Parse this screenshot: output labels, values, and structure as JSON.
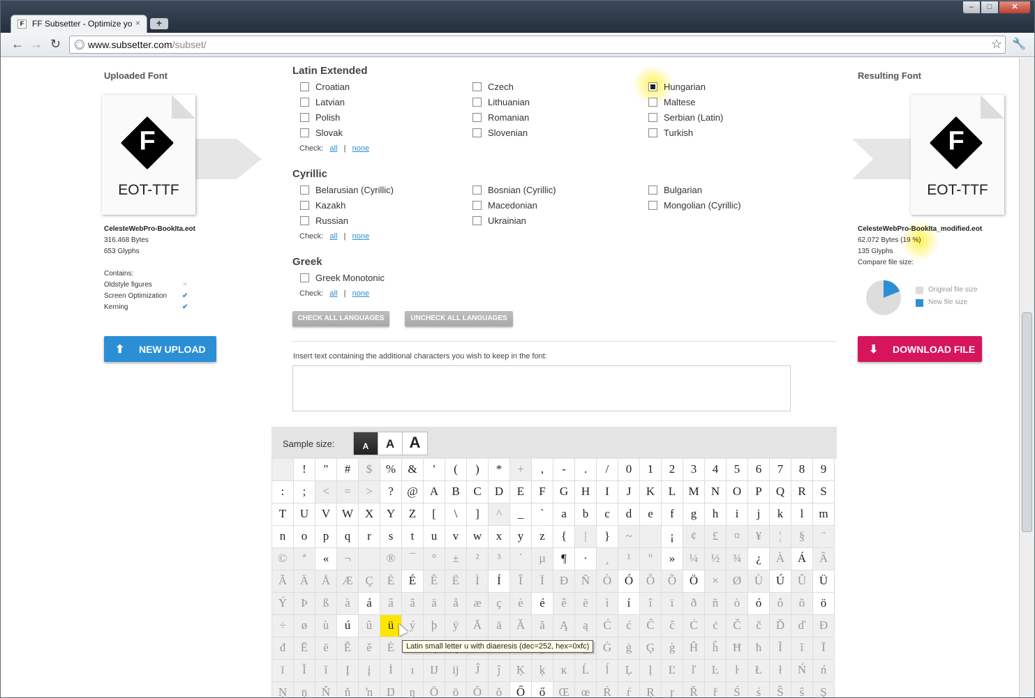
{
  "browser": {
    "tab_title": "FF Subsetter - Optimize yo",
    "tab_favicon": "F",
    "tab_close": "×",
    "new_tab": "+",
    "url_host": "www.subsetter.com",
    "url_path": "/subset/",
    "window_buttons": {
      "min": "‒",
      "max": "□",
      "close": "✕"
    }
  },
  "uploaded": {
    "heading": "Uploaded Font",
    "type": "EOT-TTF",
    "filename": "CelesteWebPro-BookIta.eot",
    "bytes": "316.468 Bytes",
    "glyphs": "653 Glyphs",
    "contains_label": "Contains:",
    "features": [
      {
        "name": "Oldstyle figures",
        "icon": "cross-icon",
        "glyph": "✕"
      },
      {
        "name": "Screen Optimization",
        "icon": "check-icon",
        "glyph": "✔"
      },
      {
        "name": "Kerning",
        "icon": "check-icon",
        "glyph": "✔"
      }
    ],
    "upload_button": "NEW UPLOAD"
  },
  "resulting": {
    "heading": "Resulting Font",
    "type": "EOT-TTF",
    "filename": "CelesteWebPro-BookIta_modified.eot",
    "bytes": "62.072 Bytes (19 %)",
    "glyphs": "135 Glyphs",
    "compare_label": "Compare file size:",
    "legend_original": "Original file size",
    "legend_new": "New file size",
    "new_fraction": 0.19,
    "colors": {
      "original": "#dddddd",
      "new": "#2b8fd6"
    },
    "download_button": "DOWNLOAD FILE"
  },
  "sections": [
    {
      "title": "Latin Extended",
      "columns": [
        [
          {
            "label": "Croatian",
            "checked": false
          },
          {
            "label": "Latvian",
            "checked": false
          },
          {
            "label": "Polish",
            "checked": false
          },
          {
            "label": "Slovak",
            "checked": false
          }
        ],
        [
          {
            "label": "Czech",
            "checked": false
          },
          {
            "label": "Lithuanian",
            "checked": false
          },
          {
            "label": "Romanian",
            "checked": false
          },
          {
            "label": "Slovenian",
            "checked": false
          }
        ],
        [
          {
            "label": "Hungarian",
            "checked": true
          },
          {
            "label": "Maltese",
            "checked": false
          },
          {
            "label": "Serbian (Latin)",
            "checked": false
          },
          {
            "label": "Turkish",
            "checked": false
          }
        ]
      ]
    },
    {
      "title": "Cyrillic",
      "columns": [
        [
          {
            "label": "Belarusian (Cyrillic)",
            "checked": false
          },
          {
            "label": "Kazakh",
            "checked": false
          },
          {
            "label": "Russian",
            "checked": false
          }
        ],
        [
          {
            "label": "Bosnian (Cyrillic)",
            "checked": false
          },
          {
            "label": "Macedonian",
            "checked": false
          },
          {
            "label": "Ukrainian",
            "checked": false
          }
        ],
        [
          {
            "label": "Bulgarian",
            "checked": false
          },
          {
            "label": "Mongolian (Cyrillic)",
            "checked": false
          }
        ]
      ]
    },
    {
      "title": "Greek",
      "columns": [
        [
          {
            "label": "Greek Monotonic",
            "checked": false
          }
        ]
      ]
    }
  ],
  "check_row": {
    "label": "Check:",
    "all": "all",
    "sep": "|",
    "none": "none"
  },
  "check_all_button": "CHECK ALL LANGUAGES",
  "uncheck_all_button": "UNCHECK ALL LANGUAGES",
  "insert_label": "Insert text containing the additional characters you wish to keep in the font:",
  "insert_value": "",
  "sample_size_label": "Sample size:",
  "sample_sizes": [
    "A",
    "A",
    "A"
  ],
  "glyph_rows": [
    [
      " ",
      "!",
      "\"",
      "#",
      "$",
      "%",
      "&",
      "'",
      "(",
      ")",
      "*",
      "+",
      ",",
      "-",
      ".",
      "/",
      "0",
      "1",
      "2",
      "3",
      "4",
      "5",
      "6",
      "7",
      "8",
      "9"
    ],
    [
      ":",
      ";",
      "<",
      "=",
      ">",
      "?",
      "@",
      "A",
      "B",
      "C",
      "D",
      "E",
      "F",
      "G",
      "H",
      "I",
      "J",
      "K",
      "L",
      "M",
      "N",
      "O",
      "P",
      "Q",
      "R",
      "S"
    ],
    [
      "T",
      "U",
      "V",
      "W",
      "X",
      "Y",
      "Z",
      "[",
      "\\",
      "]",
      "^",
      "_",
      "`",
      "a",
      "b",
      "c",
      "d",
      "e",
      "f",
      "g",
      "h",
      "i",
      "j",
      "k",
      "l",
      "m"
    ],
    [
      "n",
      "o",
      "p",
      "q",
      "r",
      "s",
      "t",
      "u",
      "v",
      "w",
      "x",
      "y",
      "z",
      "{",
      "|",
      "}",
      "~",
      " ",
      "¡",
      "¢",
      "£",
      "¤",
      "¥",
      "¦",
      "§",
      "¨"
    ],
    [
      "©",
      "ª",
      "«",
      "¬",
      "­",
      "®",
      "¯",
      "°",
      "±",
      "²",
      "³",
      "´",
      "µ",
      "¶",
      "·",
      "¸",
      "¹",
      "º",
      "»",
      "¼",
      "½",
      "¾",
      "¿",
      "À",
      "Á",
      "Â"
    ],
    [
      "Ã",
      "Ä",
      "Å",
      "Æ",
      "Ç",
      "È",
      "É",
      "Ê",
      "Ë",
      "Ì",
      "Í",
      "Î",
      "Ï",
      "Ð",
      "Ñ",
      "Ò",
      "Ó",
      "Ô",
      "Õ",
      "Ö",
      "×",
      "Ø",
      "Ù",
      "Ú",
      "Û",
      "Ü"
    ],
    [
      "Ý",
      "Þ",
      "ß",
      "à",
      "á",
      "â",
      "ã",
      "ä",
      "å",
      "æ",
      "ç",
      "è",
      "é",
      "ê",
      "ë",
      "ì",
      "í",
      "î",
      "ï",
      "ð",
      "ñ",
      "ò",
      "ó",
      "ô",
      "õ",
      "ö"
    ],
    [
      "÷",
      "ø",
      "ù",
      "ú",
      "û",
      "ü",
      "ý",
      "þ",
      "ÿ",
      "Ā",
      "ā",
      "Ă",
      "ă",
      "Ą",
      "ą",
      "Ć",
      "ć",
      "Ĉ",
      "ĉ",
      "Ċ",
      "ċ",
      "Č",
      "č",
      "Ď",
      "ď",
      "Đ"
    ],
    [
      "đ",
      "Ē",
      "ē",
      "Ĕ",
      "ĕ",
      "Ė",
      "ė",
      "Ę",
      "ę",
      "Ě",
      "ě",
      "Ĝ",
      "ĝ",
      "Ğ",
      "ğ",
      "Ġ",
      "ġ",
      "Ģ",
      "ģ",
      "Ĥ",
      "ĥ",
      "Ħ",
      "ħ",
      "Ĩ",
      "ĩ",
      "Ī"
    ],
    [
      "ī",
      "Ĭ",
      "ĭ",
      "Į",
      "į",
      "İ",
      "ı",
      "Ĳ",
      "ĳ",
      "Ĵ",
      "ĵ",
      "Ķ",
      "ķ",
      "ĸ",
      "Ĺ",
      "ĺ",
      "Ļ",
      "ļ",
      "Ľ",
      "ľ",
      "Ŀ",
      "ŀ",
      "Ł",
      "ł",
      "Ń",
      "ń"
    ],
    [
      "Ņ",
      "ņ",
      "Ň",
      "ň",
      "ŉ",
      "Ŋ",
      "ŋ",
      "Ō",
      "ō",
      "Ŏ",
      "ŏ",
      "Ő",
      "ő",
      "Œ",
      "œ",
      "Ŕ",
      "ŕ",
      "Ŗ",
      "ŗ",
      "Ř",
      "ř",
      "Ś",
      "ś",
      "Ŝ",
      "ŝ",
      "Ş"
    ]
  ],
  "glyph_active_rows": [
    [
      0,
      1,
      1,
      1,
      0,
      1,
      1,
      1,
      1,
      1,
      1,
      0,
      1,
      1,
      1,
      1,
      1,
      1,
      1,
      1,
      1,
      1,
      1,
      1,
      1,
      1
    ],
    [
      1,
      1,
      0,
      0,
      0,
      1,
      1,
      1,
      1,
      1,
      1,
      1,
      1,
      1,
      1,
      1,
      1,
      1,
      1,
      1,
      1,
      1,
      1,
      1,
      1,
      1
    ],
    [
      1,
      1,
      1,
      1,
      1,
      1,
      1,
      1,
      1,
      1,
      0,
      1,
      1,
      1,
      1,
      1,
      1,
      1,
      1,
      1,
      1,
      1,
      1,
      1,
      1,
      1
    ],
    [
      1,
      1,
      1,
      1,
      1,
      1,
      1,
      1,
      1,
      1,
      1,
      1,
      1,
      1,
      0,
      1,
      0,
      0,
      1,
      0,
      0,
      0,
      0,
      0,
      0,
      0
    ],
    [
      0,
      0,
      1,
      0,
      0,
      0,
      0,
      0,
      0,
      0,
      0,
      0,
      0,
      1,
      1,
      0,
      0,
      0,
      1,
      0,
      0,
      0,
      1,
      0,
      1,
      0
    ],
    [
      0,
      0,
      0,
      0,
      0,
      0,
      1,
      0,
      0,
      0,
      1,
      0,
      0,
      0,
      0,
      0,
      1,
      0,
      0,
      1,
      0,
      0,
      0,
      1,
      0,
      1
    ],
    [
      0,
      0,
      0,
      0,
      1,
      0,
      0,
      0,
      0,
      0,
      0,
      0,
      1,
      0,
      0,
      0,
      1,
      0,
      0,
      0,
      0,
      0,
      1,
      0,
      0,
      1
    ],
    [
      0,
      0,
      0,
      1,
      0,
      1,
      0,
      0,
      0,
      0,
      0,
      0,
      0,
      0,
      0,
      0,
      0,
      0,
      0,
      0,
      0,
      0,
      0,
      0,
      0,
      0
    ],
    [
      0,
      0,
      0,
      0,
      0,
      0,
      0,
      0,
      0,
      0,
      0,
      0,
      0,
      0,
      0,
      0,
      0,
      0,
      0,
      0,
      0,
      0,
      0,
      0,
      0,
      0
    ],
    [
      0,
      0,
      0,
      0,
      0,
      0,
      0,
      0,
      0,
      0,
      0,
      0,
      0,
      0,
      0,
      0,
      0,
      0,
      0,
      0,
      0,
      0,
      0,
      0,
      0,
      0
    ],
    [
      0,
      0,
      0,
      0,
      0,
      0,
      0,
      0,
      0,
      0,
      0,
      1,
      1,
      0,
      0,
      0,
      0,
      0,
      0,
      0,
      0,
      0,
      0,
      0,
      0,
      0
    ]
  ],
  "hovered_glyph": {
    "row": 7,
    "col": 5
  },
  "tooltip": "Latin small letter u with diaeresis (dec=252, hex=0xfc)"
}
